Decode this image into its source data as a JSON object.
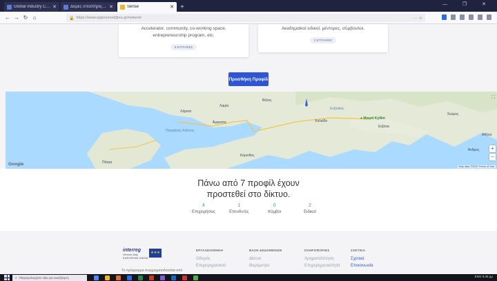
{
  "browser": {
    "tabs": [
      {
        "title": "Global Industry Classificatio",
        "active": false
      },
      {
        "title": "Δομές υποστήριξης | Innovation",
        "active": false
      },
      {
        "title": "Sense",
        "active": true
      }
    ],
    "new_tab_icon": "+",
    "url": "https://www.eppmonod@eu.gr/network",
    "menu_dots": "··· ☆"
  },
  "cards": [
    {
      "desc": "Accelerator, community, co-working space, entrepreneurship program, etc.",
      "badge": "8 ΕΓΓΡΑΦΕΣ"
    },
    {
      "desc": "Ακαδημαϊκοί ειδικοί, μέντορες, σύμβουλοι.",
      "badge": "2 ΕΓΓΡΑΦΕΣ"
    }
  ],
  "add_profile_button": "Προσθήκη Προφίλ",
  "map": {
    "labels": [
      {
        "text": "Λάρισα"
      },
      {
        "text": "Βόλος"
      },
      {
        "text": "Χαλκίδα"
      },
      {
        "text": "Λαμία"
      },
      {
        "text": "Εύβοια"
      },
      {
        "text": "Άμφισσα"
      },
      {
        "text": "Αθήνα"
      },
      {
        "text": "Πάτρα"
      },
      {
        "text": "Κόρινθος"
      },
      {
        "text": "Σκύρος"
      },
      {
        "text": "Άνδρος"
      }
    ],
    "water_labels": [
      {
        "text": "Πατραϊκός Κόλπος"
      },
      {
        "text": "Ευβοϊκός"
      }
    ],
    "place_label": "Mount Kyllini",
    "google": "Google",
    "credit": "Map data ©2020   Terms of Use",
    "zoom_in": "+",
    "zoom_out": "−",
    "marker_color": "#3b5bdb"
  },
  "stats": {
    "title_line1": "Πάνω από 7 προφίλ έχουν",
    "title_line2": "προστεθεί στο δίκτυο.",
    "items": [
      {
        "num": "4",
        "label": "Επιχειρήσεις"
      },
      {
        "num": "1",
        "label": "Επενδυτές"
      },
      {
        "num": "0",
        "label": "Κόμβοι"
      },
      {
        "num": "2",
        "label": "Ειδικοί"
      }
    ]
  },
  "footer": {
    "logo_text": "interreg",
    "logo_sub": "Greece-Italy",
    "logo_sub2": "EUROPEAN UNION",
    "caption": "Το πρόγραμμα συγχρηματοδοτείται από",
    "columns": [
      {
        "title": "ΕΡΓΑΛΕΙΟΘΗΚΗ",
        "items": [
          "Οδηγός",
          "Επιχειρηματικού"
        ]
      },
      {
        "title": "ΒΑΣΗ ΔΕΔΟΜΕΝΩΝ",
        "items": [
          "Δίκτυο",
          "Βαρόμετρο"
        ]
      },
      {
        "title": "ΠΛΗΡΟΦΟΡΙΕΣ",
        "items": [
          "Χρηματοδότηση",
          "Επιχειρηματικότητα"
        ]
      },
      {
        "title": "ΣΧΕΤΙΚΑ",
        "items": [
          "Σχετικά",
          "Επικοινωνία"
        ]
      }
    ]
  },
  "taskbar": {
    "search_placeholder": "Πληκτρολογήστε εδώ για αναζήτηση",
    "tray": "ENG  5:45 μμ"
  },
  "colors": {
    "accent": "#2f55d4",
    "stat_green": "#3fa96d"
  }
}
